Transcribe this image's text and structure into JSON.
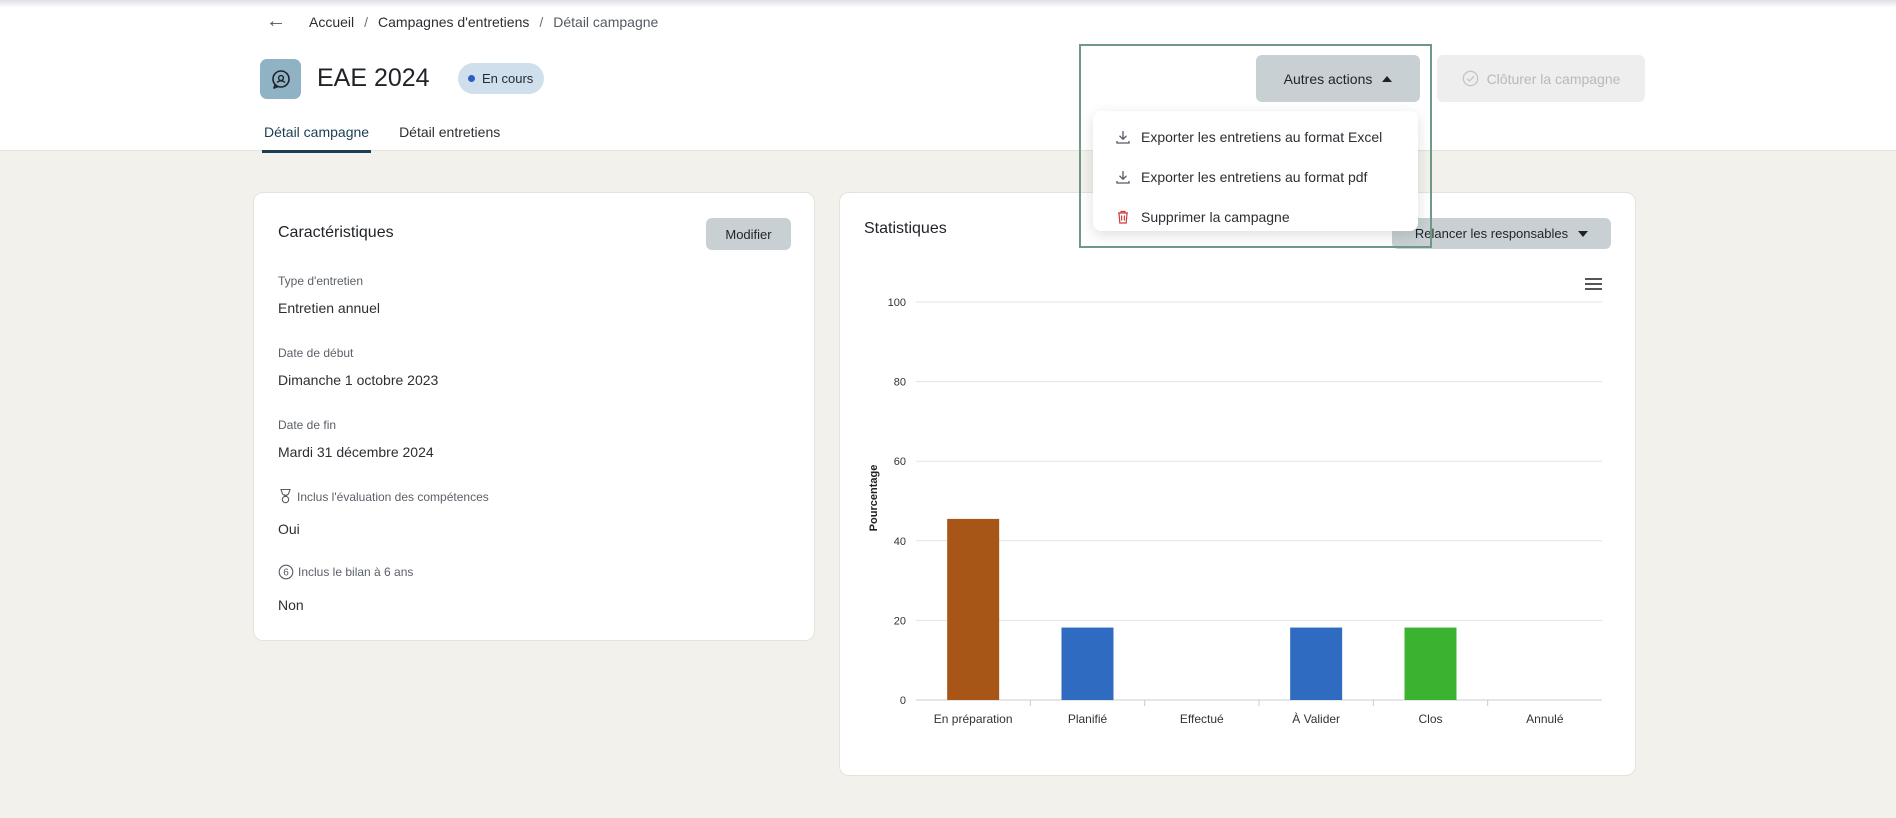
{
  "breadcrumb": {
    "items": [
      "Accueil",
      "Campagnes d'entretiens",
      "Détail campagne"
    ],
    "sep": "/"
  },
  "header": {
    "title": "EAE 2024",
    "status": "En cours",
    "more_actions": "Autres actions",
    "close_campaign": "Clôturer la campagne"
  },
  "tabs": [
    "Détail campagne",
    "Détail entretiens"
  ],
  "dropdown": {
    "items": [
      "Exporter les entretiens au format Excel",
      "Exporter les entretiens au format pdf",
      "Supprimer la campagne"
    ]
  },
  "characteristics": {
    "title": "Caractéristiques",
    "modify": "Modifier",
    "fields": [
      {
        "label": "Type d'entretien",
        "value": "Entretien annuel"
      },
      {
        "label": "Date de début",
        "value": "Dimanche 1 octobre 2023"
      },
      {
        "label": "Date de fin",
        "value": "Mardi 31 décembre 2024"
      },
      {
        "label": "Inclus l'évaluation des compétences",
        "value": "Oui"
      },
      {
        "label": "Inclus le bilan à 6 ans",
        "value": "Non"
      }
    ]
  },
  "statistics": {
    "title": "Statistiques",
    "remind": "Relancer les responsables"
  },
  "colors": {
    "status_dot": "#2b5fc7",
    "bar_prep": "#a85618",
    "bar_blue": "#2e6bc1",
    "bar_green": "#3bb331",
    "delete_red": "#d23b3b"
  },
  "chart_data": {
    "type": "bar",
    "categories": [
      "En préparation",
      "Planifié",
      "Effectué",
      "À Valider",
      "Clos",
      "Annulé"
    ],
    "values": [
      45.5,
      18.2,
      0,
      18.2,
      18.2,
      0
    ],
    "bar_colors": [
      "#a85618",
      "#2e6bc1",
      "#2e6bc1",
      "#2e6bc1",
      "#3bb331",
      "#3bb331"
    ],
    "ylabel": "Pourcentage",
    "ylim": [
      0,
      100
    ],
    "yticks": [
      0,
      20,
      40,
      60,
      80,
      100
    ],
    "grid": true
  }
}
